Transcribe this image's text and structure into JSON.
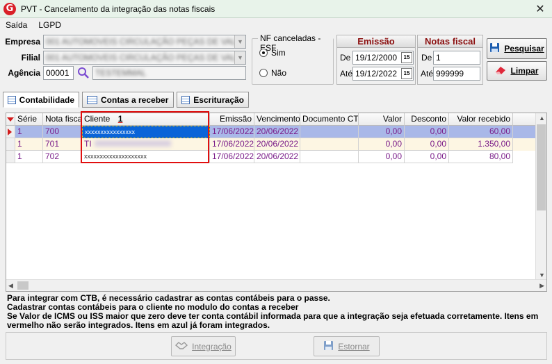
{
  "window": {
    "title": "PVT - Cancelamento da integração das notas fiscais",
    "close": "✕"
  },
  "menu": [
    "Saída",
    "LGPD"
  ],
  "filters": {
    "empresa_label": "Empresa",
    "empresa_value": "001 AUTOMOVEIS CIRCULAÇÃO PEÇAS DE VALEIS",
    "filial_label": "Filial",
    "filial_value": "001 AUTOMOVEIS CIRCULAÇÃO PEÇAS DE VALEIS",
    "agencia_label": "Agência",
    "agencia_code": "00001",
    "agencia_name": "TESTEMMAL"
  },
  "nf_group": {
    "title": "NF canceladas - ESF",
    "opt_yes": "Sim",
    "opt_no": "Não",
    "selected": "Sim"
  },
  "emissao": {
    "title": "Emissão",
    "de_label": "De",
    "de_value": "19/12/2000",
    "ate_label": "Até",
    "ate_value": "19/12/2022",
    "cal_icon": "15"
  },
  "notas": {
    "title": "Notas fiscal",
    "de_label": "De",
    "de_value": "1",
    "ate_label": "Até",
    "ate_value": "999999"
  },
  "buttons": {
    "pesquisar": "Pesquisar",
    "limpar": "Limpar",
    "integracao": "Integração",
    "estornar": "Estornar"
  },
  "tabs": [
    "Contabilidade",
    "Contas a receber",
    "Escrituração"
  ],
  "grid": {
    "columns": [
      "Série",
      "Nota fiscal",
      "Cliente",
      "Emissão",
      "Vencimento",
      "Documento CTB",
      "Valor",
      "Desconto",
      "Valor recebido"
    ],
    "cliente_sort_marker": "1",
    "rows": [
      {
        "serie": "1",
        "nota": "700",
        "cliente": "xxxxxxxxxxxxxxxx",
        "emissao": "17/06/2022",
        "vencimento": "20/06/2022",
        "documento": "",
        "valor": "0,00",
        "desconto": "0,00",
        "recebido": "60,00"
      },
      {
        "serie": "1",
        "nota": "701",
        "cliente": "TI",
        "emissao": "17/06/2022",
        "vencimento": "20/06/2022",
        "documento": "",
        "valor": "0,00",
        "desconto": "0,00",
        "recebido": "1.350,00"
      },
      {
        "serie": "1",
        "nota": "702",
        "cliente": "xxxxxxxxxxxxxxxxxxxx",
        "emissao": "17/06/2022",
        "vencimento": "20/06/2022",
        "documento": "",
        "valor": "0,00",
        "desconto": "0,00",
        "recebido": "80,00"
      }
    ]
  },
  "info": {
    "line1": "Para integrar com CTB, é necessário cadastrar as contas contábeis para o passe.",
    "line2": "Cadastrar contas contábeis para o cliente no modulo do contas a receber",
    "line3": "Se Valor de ICMS ou ISS maior que zero deve ter conta contábil informada para que a integração seja efetuada corretamente. Itens em vermelho não serão integrados. Itens em azul já foram integrados."
  },
  "colors": {
    "accent_red": "#d21b1b",
    "panel_title": "#8b0e0e",
    "row_text": "#7a1c89",
    "selected_row": "#a9b8e8",
    "row_alt": "#fdf6e3"
  }
}
